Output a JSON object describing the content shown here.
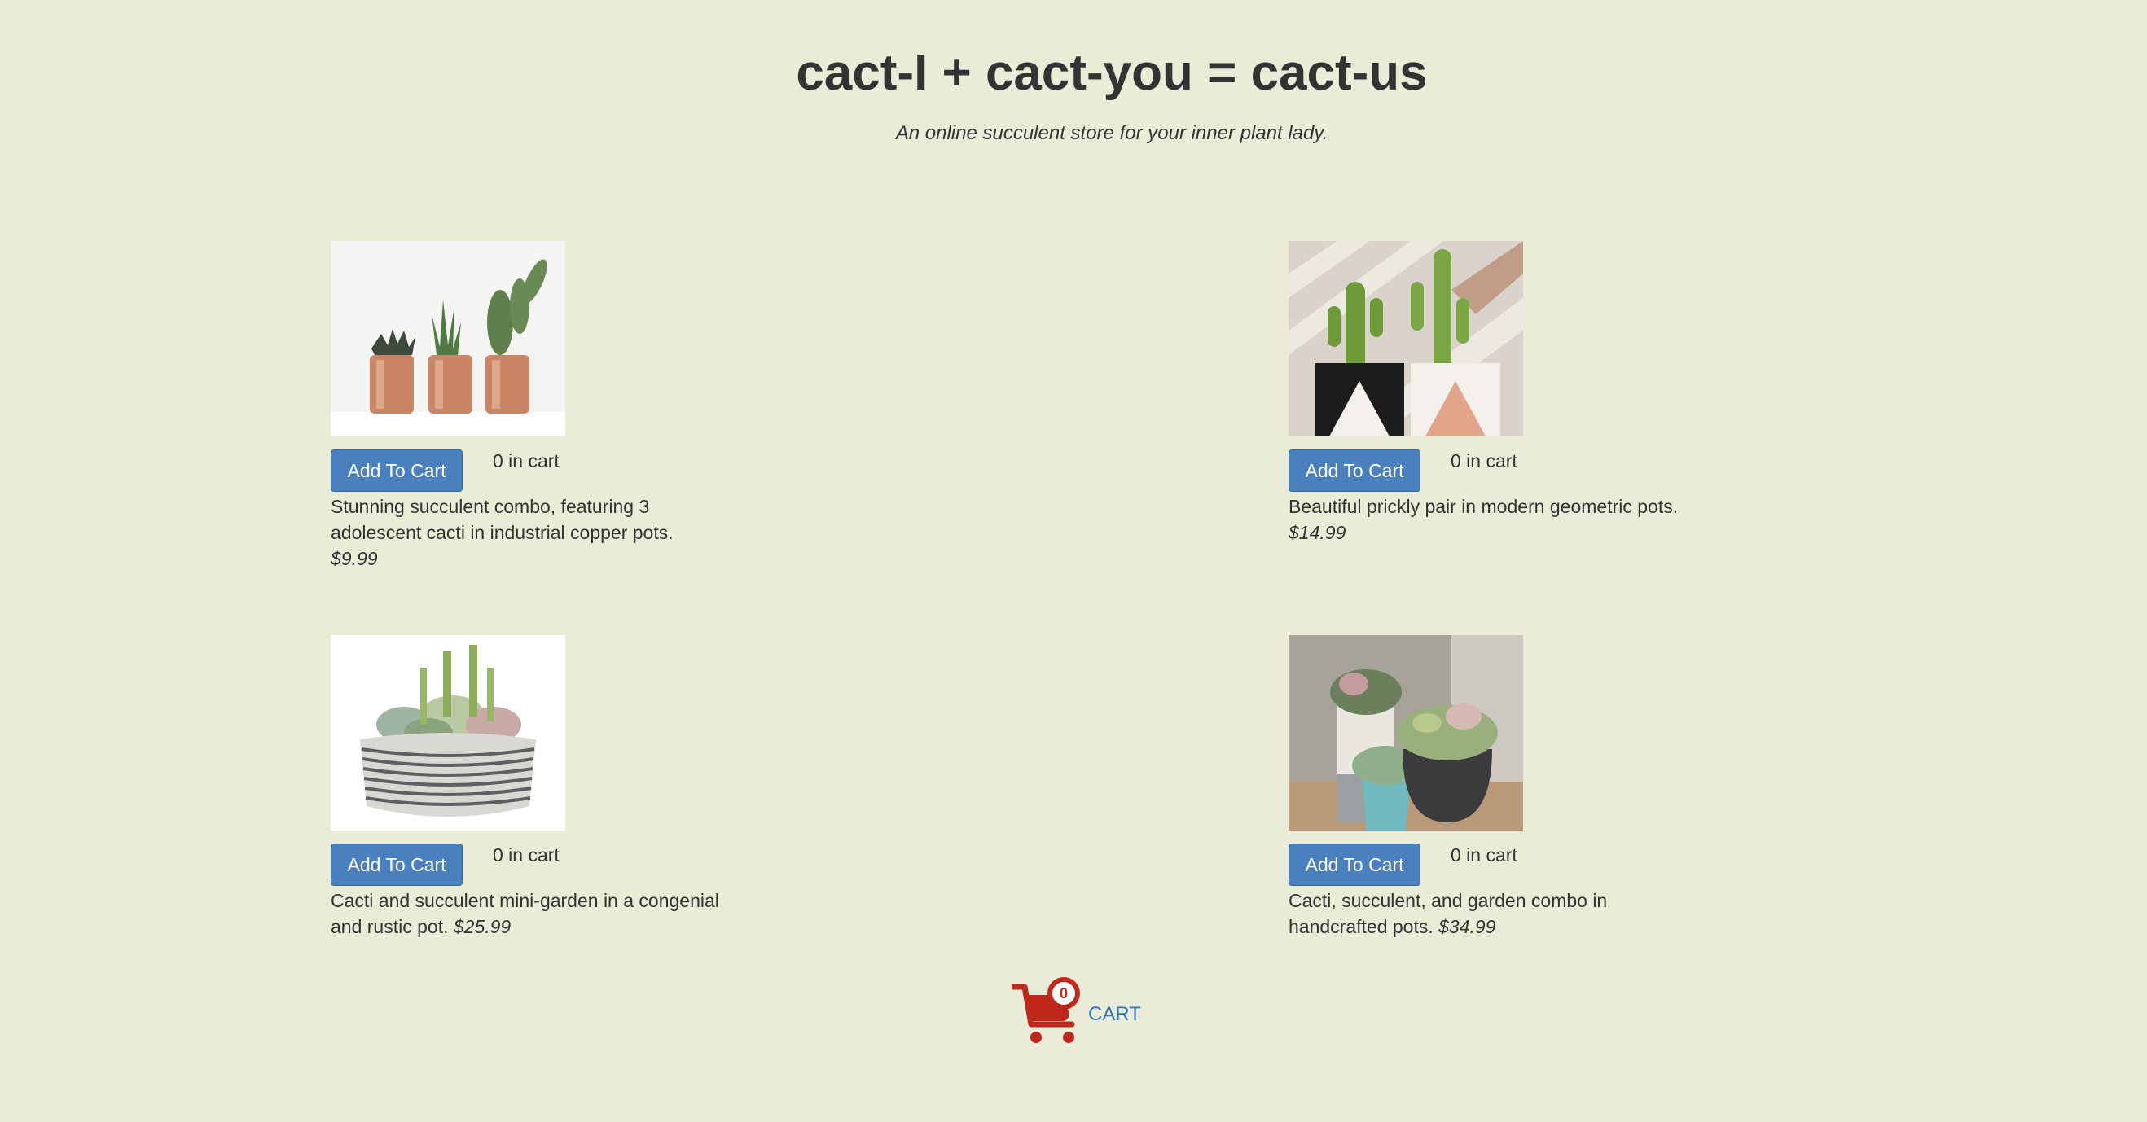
{
  "header": {
    "title": "cact-I + cact-you = cact-us",
    "subtitle": "An online succulent store for your inner plant lady."
  },
  "products": [
    {
      "image_icon": "copper-pots-cacti-image",
      "button_label": "Add To Cart",
      "count_label": "0 in cart",
      "description": "Stunning succulent combo, featuring 3 adolescent cacti in industrial copper pots.",
      "price": "$9.99"
    },
    {
      "image_icon": "geometric-pots-cacti-image",
      "button_label": "Add To Cart",
      "count_label": "0 in cart",
      "description": "Beautiful prickly pair in modern geometric pots.",
      "price": "$14.99"
    },
    {
      "image_icon": "mini-garden-bowl-image",
      "button_label": "Add To Cart",
      "count_label": "0 in cart",
      "description": "Cacti and succulent mini-garden in a congenial and rustic pot.",
      "price": "$25.99"
    },
    {
      "image_icon": "handcrafted-pots-succulents-image",
      "button_label": "Add To Cart",
      "count_label": "0 in cart",
      "description": "Cacti, succulent, and garden combo in handcrafted pots.",
      "price": "$34.99"
    }
  ],
  "cart": {
    "count": "0",
    "label": "CART"
  },
  "colors": {
    "background": "#ebecd8",
    "button": "#4a80bd",
    "cart_icon": "#c0281c",
    "cart_link": "#337ab7"
  }
}
